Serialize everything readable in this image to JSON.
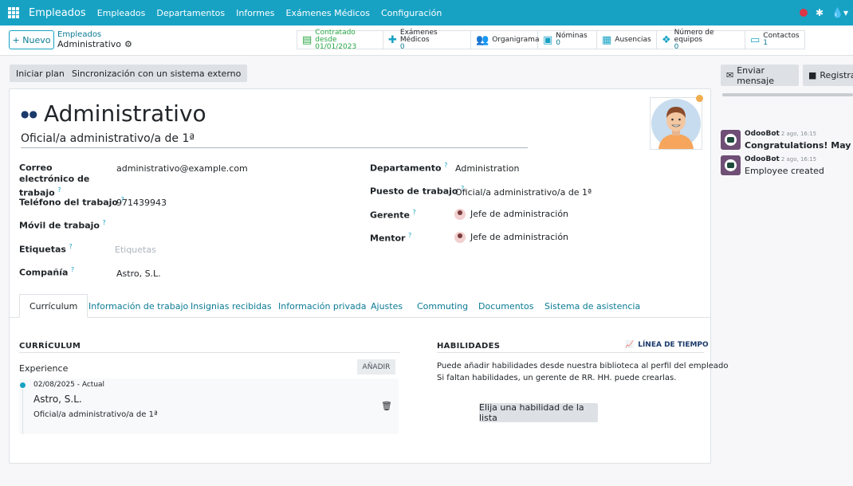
{
  "navbar": {
    "app_name": "Empleados",
    "items": [
      "Empleados",
      "Departamentos",
      "Informes",
      "Exámenes Médicos",
      "Configuración"
    ]
  },
  "control": {
    "new_label": "+ Nuevo",
    "breadcrumb_parent": "Empleados",
    "breadcrumb_current": "Administrativo",
    "stats": [
      {
        "label": "Contratado desde",
        "value": "01/01/2023",
        "icon": "contract-icon"
      },
      {
        "label": "Exámenes Médicos",
        "value": "0",
        "icon": "medical-kit-icon"
      },
      {
        "label": "Organigrama",
        "value": "",
        "icon": "users-icon"
      },
      {
        "label": "Nóminas",
        "value": "0",
        "icon": "money-icon"
      },
      {
        "label": "Ausencias",
        "value": "",
        "icon": "calendar-icon"
      },
      {
        "label": "Número de equipos",
        "value": "0",
        "icon": "cubes-icon"
      },
      {
        "label": "Contactos",
        "value": "1",
        "icon": "address-card-icon"
      }
    ]
  },
  "actions": {
    "start_plan": "Iniciar plan",
    "sync": "Sincronización con un sistema externo"
  },
  "employee": {
    "name": "Administrativo",
    "job_title": "Oficial/a administrativo/a de 1ª",
    "work_email_label": "Correo electrónico de trabajo",
    "work_email": "administrativo@example.com",
    "work_phone_label": "Teléfono del trabajo",
    "work_phone": "971439943",
    "mobile_label": "Móvil de trabajo",
    "mobile": "",
    "tags_label": "Etiquetas",
    "tags_placeholder": "Etiquetas",
    "company_label": "Compañía",
    "company": "Astro, S.L.",
    "department_label": "Departamento",
    "department": "Administration",
    "job_position_label": "Puesto de trabajo",
    "job_position": "Oficial/a administrativo/a de 1ª",
    "manager_label": "Gerente",
    "manager": "Jefe de administración",
    "coach_label": "Mentor",
    "coach": "Jefe de administración"
  },
  "tabs": [
    "Currículum",
    "Información de trabajo",
    "Insignias recibidas",
    "Información privada",
    "Ajustes",
    "Commuting",
    "Documentos",
    "Sistema de asistencia"
  ],
  "resume": {
    "title": "CURRÍCULUM",
    "group": "Experience",
    "add_label": "AÑADIR",
    "entry_dates": "02/08/2025 - Actual",
    "entry_company": "Astro, S.L.",
    "entry_role": "Oficial/a administrativo/a de 1ª"
  },
  "skills": {
    "title": "HABILIDADES",
    "timeline_label": "LÍNEA DE TIEMPO",
    "line1": "Puede añadir habilidades desde nuestra biblioteca al perfil del empleado",
    "line2": "Si faltan habilidades, un gerente de RR. HH. puede crearlas.",
    "pick_label": "Elija una habilidad de la lista"
  },
  "chatter": {
    "send_message": "Enviar mensaje",
    "log_note": "Registrar",
    "messages": [
      {
        "author": "OdooBot",
        "time": "2 ago, 16:15",
        "body": "Congratulations! May I reco"
      },
      {
        "author": "OdooBot",
        "time": "2 ago, 16:15",
        "body": "Employee created"
      }
    ]
  }
}
